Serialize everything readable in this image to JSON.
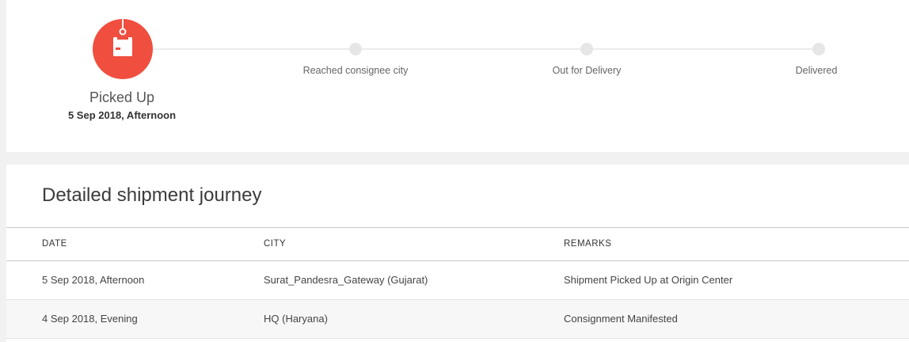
{
  "colors": {
    "accent": "#f04e3e",
    "pending_dot": "#e6e6e6",
    "track_line": "#ececec"
  },
  "progress": {
    "current_step": {
      "label": "Picked Up",
      "date": "5 Sep 2018, Afternoon",
      "icon": "package-hook-icon"
    },
    "pending_steps": [
      {
        "label": "Reached consignee city"
      },
      {
        "label": "Out for Delivery"
      },
      {
        "label": "Delivered"
      }
    ]
  },
  "journey": {
    "title": "Detailed shipment journey",
    "columns": [
      "DATE",
      "CITY",
      "REMARKS"
    ],
    "rows": [
      {
        "date": "5 Sep 2018, Afternoon",
        "city": "Surat_Pandesra_Gateway (Gujarat)",
        "remarks": "Shipment Picked Up at Origin Center"
      },
      {
        "date": "4 Sep 2018, Evening",
        "city": "HQ (Haryana)",
        "remarks": "Consignment Manifested"
      }
    ]
  }
}
